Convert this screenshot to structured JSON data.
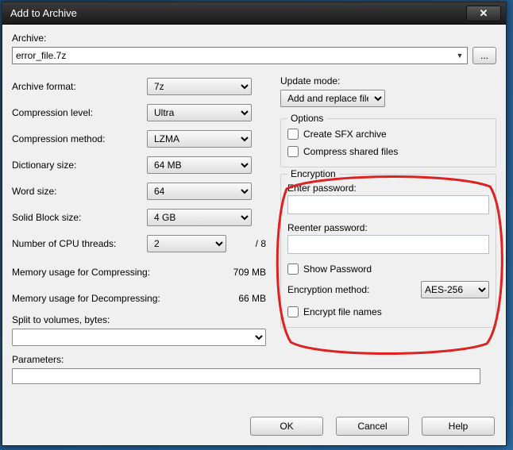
{
  "window": {
    "title": "Add to Archive"
  },
  "archive": {
    "label": "Archive:",
    "value": "error_file.7z",
    "browse": "..."
  },
  "left": {
    "format_label": "Archive format:",
    "format_value": "7z",
    "level_label": "Compression level:",
    "level_value": "Ultra",
    "method_label": "Compression method:",
    "method_value": "LZMA",
    "dict_label": "Dictionary size:",
    "dict_value": "64 MB",
    "word_label": "Word size:",
    "word_value": "64",
    "solid_label": "Solid Block size:",
    "solid_value": "4 GB",
    "threads_label": "Number of CPU threads:",
    "threads_value": "2",
    "threads_suffix": "/ 8",
    "mem_comp_label": "Memory usage for Compressing:",
    "mem_comp_value": "709 MB",
    "mem_decomp_label": "Memory usage for Decompressing:",
    "mem_decomp_value": "66 MB",
    "split_label": "Split to volumes, bytes:",
    "split_value": "",
    "param_label": "Parameters:",
    "param_value": ""
  },
  "right": {
    "update_label": "Update mode:",
    "update_value": "Add and replace files",
    "options_label": "Options",
    "sfx_label": "Create SFX archive",
    "shared_label": "Compress shared files",
    "enc_label": "Encryption",
    "pw_label": "Enter password:",
    "pw2_label": "Reenter password:",
    "show_pw_label": "Show Password",
    "enc_method_label": "Encryption method:",
    "enc_method_value": "AES-256",
    "enc_names_label": "Encrypt file names"
  },
  "buttons": {
    "ok": "OK",
    "cancel": "Cancel",
    "help": "Help"
  },
  "annotation_color": "#d22"
}
